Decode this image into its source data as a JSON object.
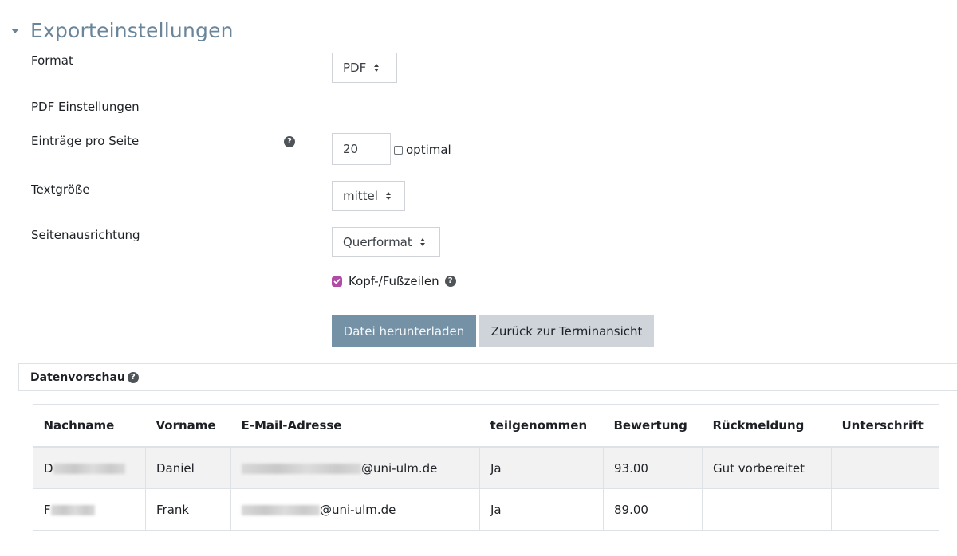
{
  "section": {
    "title": "Exporteinstellungen"
  },
  "form": {
    "format": {
      "label": "Format",
      "value": "PDF"
    },
    "pdf_settings_label": "PDF Einstellungen",
    "entries_per_page": {
      "label": "Einträge pro Seite",
      "value": "20",
      "optimal_label": "optimal",
      "optimal_checked": false
    },
    "text_size": {
      "label": "Textgröße",
      "value": "mittel"
    },
    "orientation": {
      "label": "Seitenausrichtung",
      "value": "Querformat"
    },
    "header_footer": {
      "label": "Kopf-/Fußzeilen",
      "checked": true
    },
    "download_button": "Datei herunterladen",
    "back_button": "Zurück zur Terminansicht"
  },
  "preview": {
    "title": "Datenvorschau",
    "columns": [
      "Nachname",
      "Vorname",
      "E-Mail-Adresse",
      "teilgenommen",
      "Bewertung",
      "Rückmeldung",
      "Unterschrift"
    ],
    "rows": [
      {
        "lastname_initial": "D",
        "firstname": "Daniel",
        "email_domain": "@uni-ulm.de",
        "attended": "Ja",
        "grade": "93.00",
        "feedback": "Gut vorbereitet",
        "signature": ""
      },
      {
        "lastname_initial": "F",
        "firstname": "Frank",
        "email_domain": "@uni-ulm.de",
        "attended": "Ja",
        "grade": "89.00",
        "feedback": "",
        "signature": ""
      }
    ]
  },
  "colors": {
    "accent": "#6a8599",
    "primary_button": "#7591a6",
    "checkbox": "#b04ba6"
  }
}
